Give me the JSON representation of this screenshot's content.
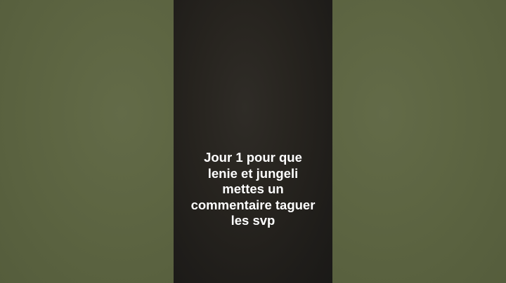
{
  "caption": {
    "lines": [
      "Jour 1 pour que",
      "lenie et jungeli",
      "mettes un",
      "commentaire taguer",
      "les svp"
    ]
  },
  "colors": {
    "side_background": "#5c6440",
    "video_background": "#1f1d1a",
    "caption_text": "#ffffff"
  }
}
